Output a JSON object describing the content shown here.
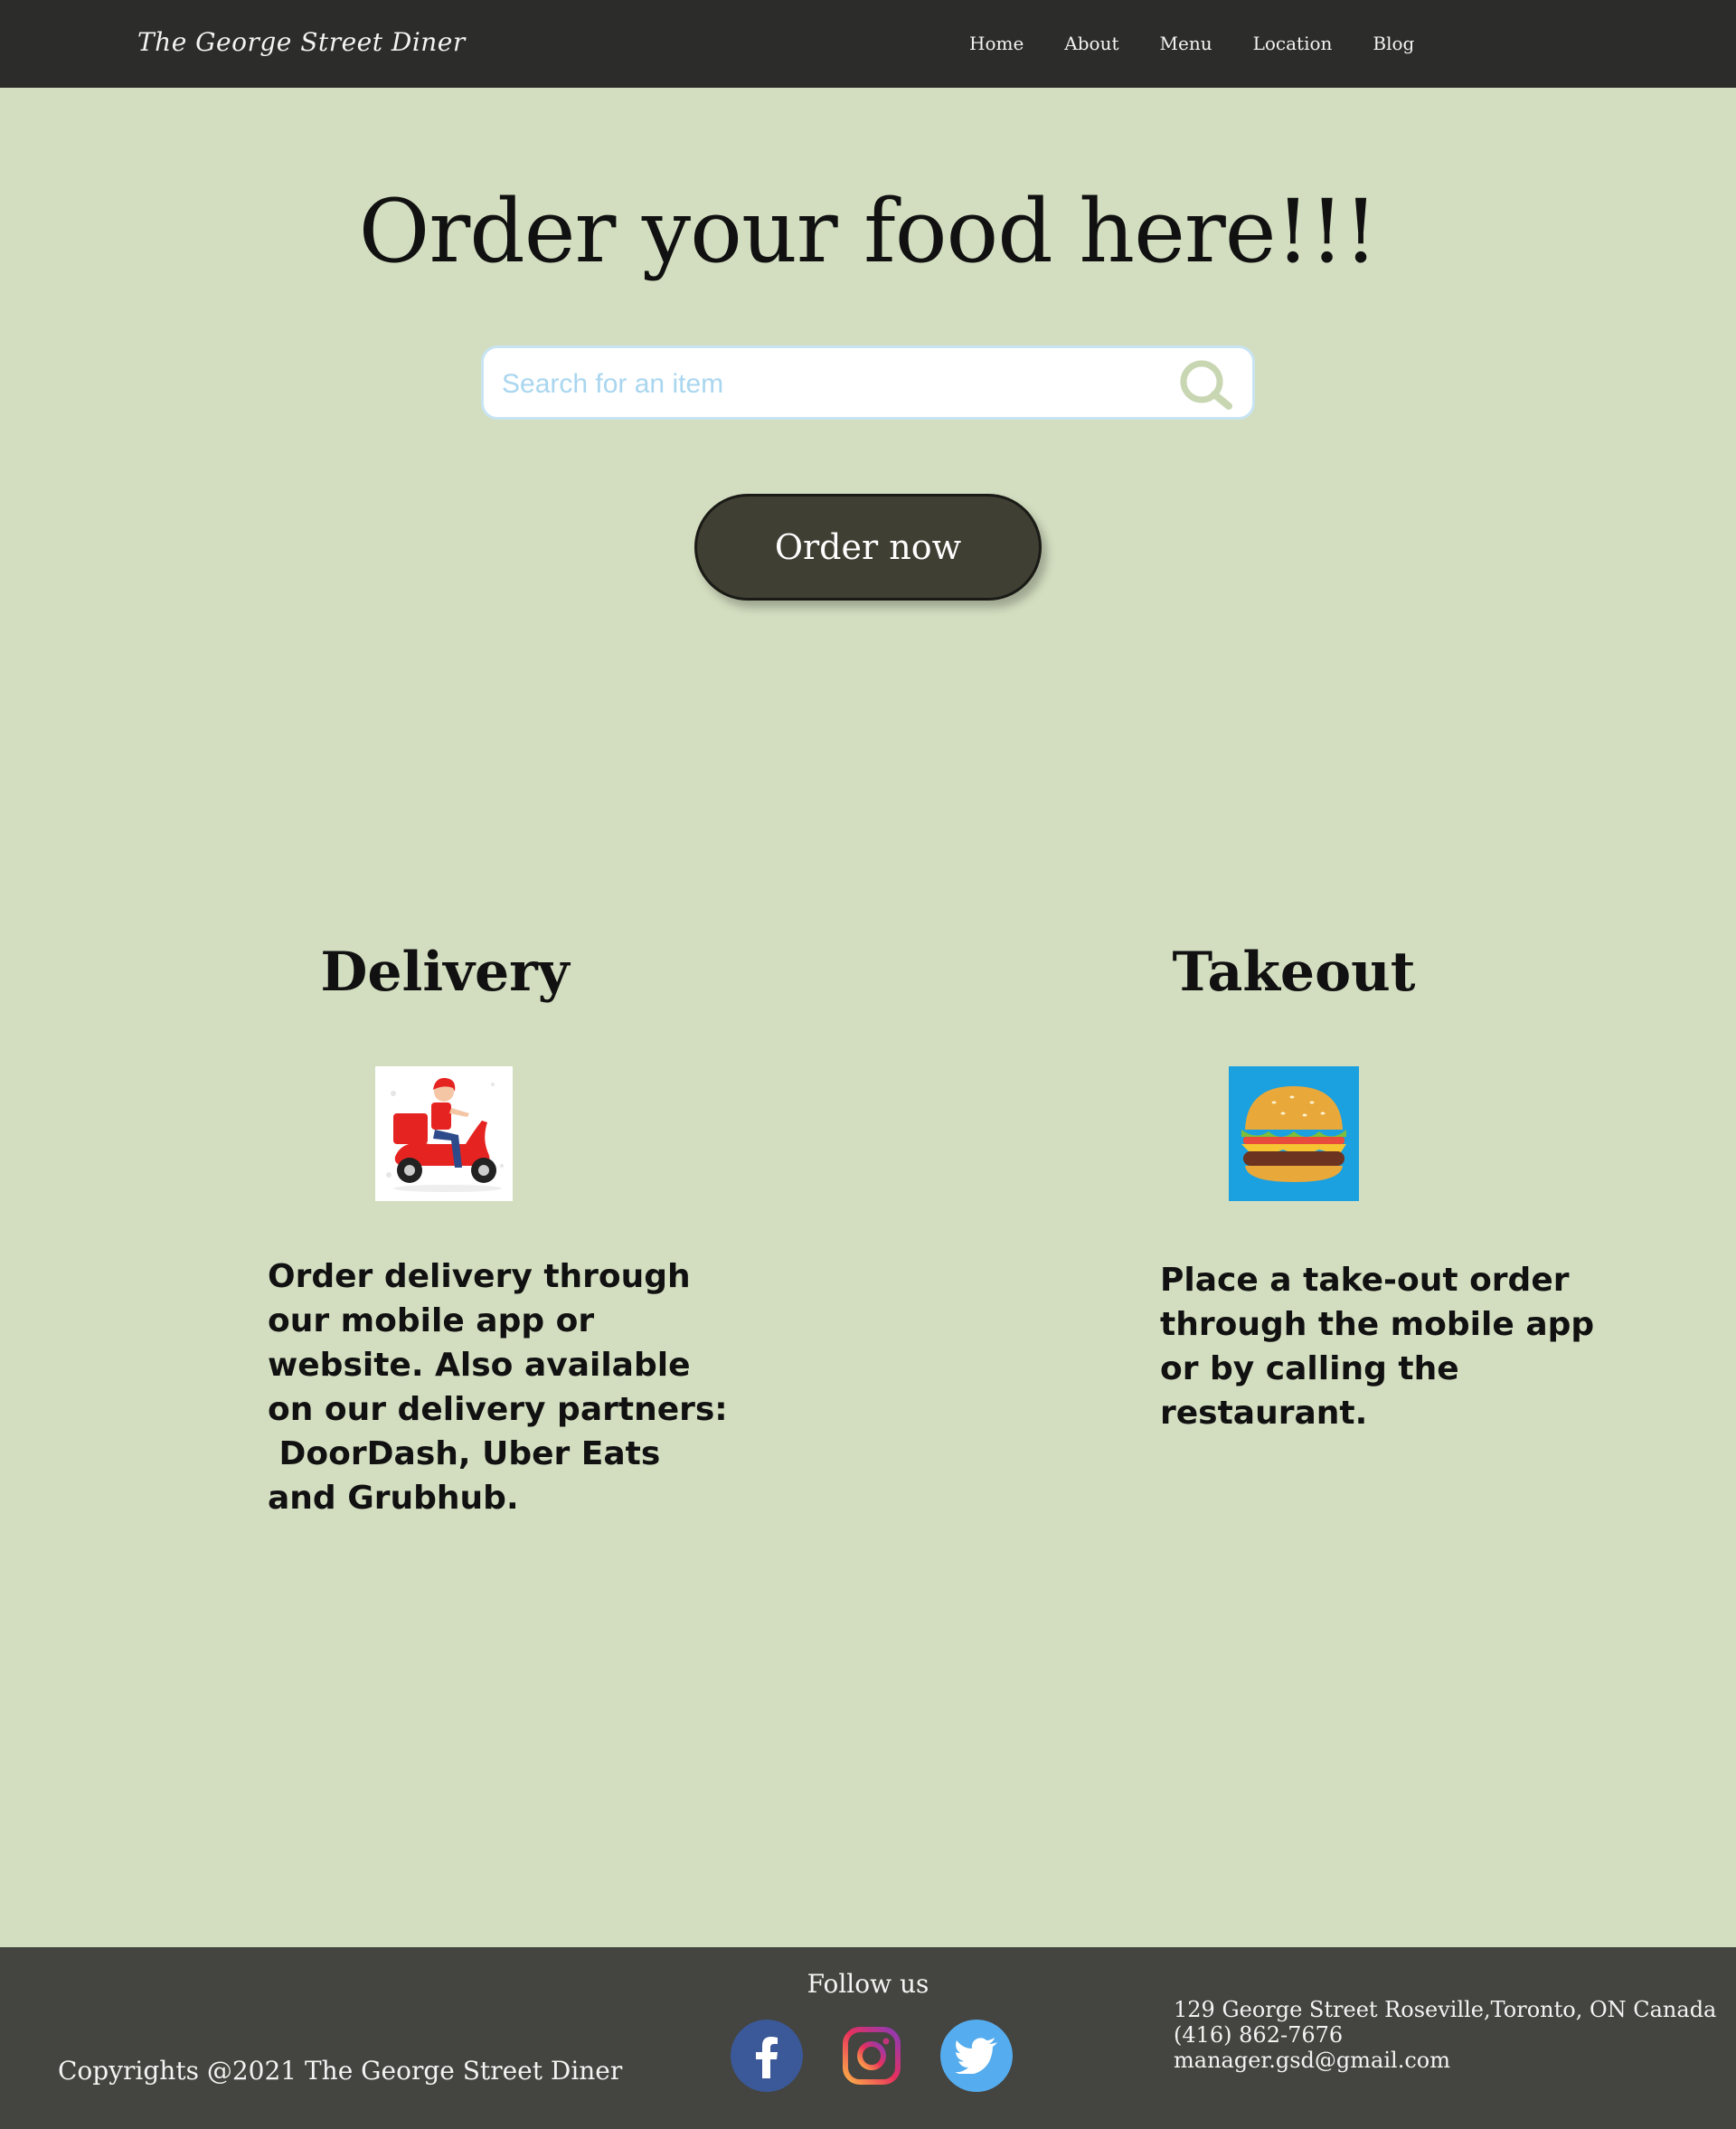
{
  "brand": "The George Street Diner",
  "nav": [
    "Home",
    "About",
    "Menu",
    "Location",
    "Blog"
  ],
  "hero": {
    "title": "Order your food here!!!",
    "search_placeholder": "Search for an item",
    "order_button": "Order now"
  },
  "delivery": {
    "title": "Delivery",
    "text": "Order delivery through\nour mobile app or\nwebsite. Also available\non our delivery partners:\n DoorDash, Uber Eats\nand Grubhub."
  },
  "takeout": {
    "title": "Takeout",
    "text": "Place a take-out order\nthrough the mobile app\nor by calling the\nrestaurant."
  },
  "footer": {
    "copyright": "Copyrights @2021 The George Street Diner",
    "follow": "Follow us",
    "address": "129 George Street Roseville,Toronto, ON Canada",
    "phone": "(416) 862-7676",
    "email": "manager.gsd@gmail.com"
  },
  "colors": {
    "page_bg": "#d3dec0",
    "header_bg": "#2c2c2a",
    "footer_bg": "#444440",
    "button_bg": "#3f3f33"
  },
  "icons": [
    "search-icon",
    "scooter-delivery-image",
    "burger-image",
    "facebook-icon",
    "instagram-icon",
    "twitter-icon"
  ]
}
